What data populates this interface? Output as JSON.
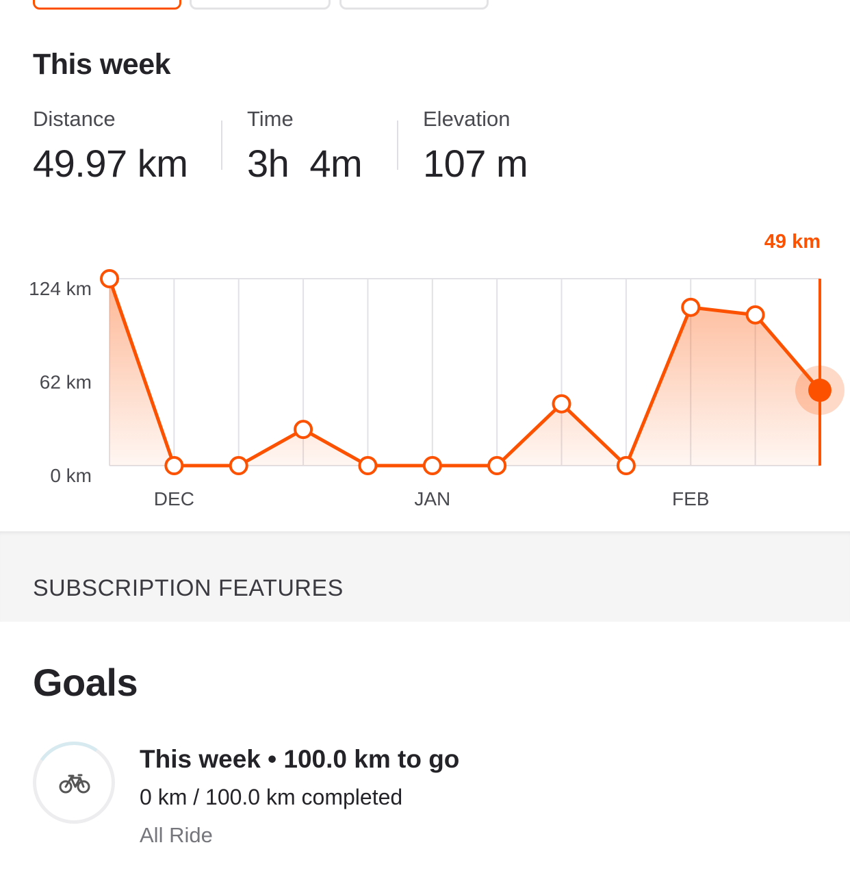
{
  "colors": {
    "accent": "#fc5200",
    "grid": "#e2e2e6",
    "text_primary": "#242428",
    "text_secondary": "#494950"
  },
  "summary": {
    "title": "This week",
    "stats": [
      {
        "label": "Distance",
        "value": "49.97 km"
      },
      {
        "label": "Time",
        "value": "3h  4m"
      },
      {
        "label": "Elevation",
        "value": "107 m"
      }
    ]
  },
  "chart_data": {
    "type": "area",
    "y_ticks": [
      "124 km",
      "62 km",
      "0 km"
    ],
    "ylim": [
      0,
      124
    ],
    "x_month_labels": [
      {
        "label": "DEC",
        "week_index": 1
      },
      {
        "label": "JAN",
        "week_index": 5
      },
      {
        "label": "FEB",
        "week_index": 9
      }
    ],
    "values": [
      124,
      0,
      0,
      24,
      0,
      0,
      0,
      41,
      0,
      105,
      100,
      50
    ],
    "selected_index": 11,
    "selected_label": "49 km",
    "grid": true
  },
  "section_header": "SUBSCRIPTION FEATURES",
  "goals": {
    "heading": "Goals",
    "item": {
      "icon": "bike-icon",
      "title": "This week • 100.0 km to go",
      "progress_text": "0 km / 100.0 km completed",
      "progress_fraction": 0,
      "type": "All Ride"
    }
  }
}
